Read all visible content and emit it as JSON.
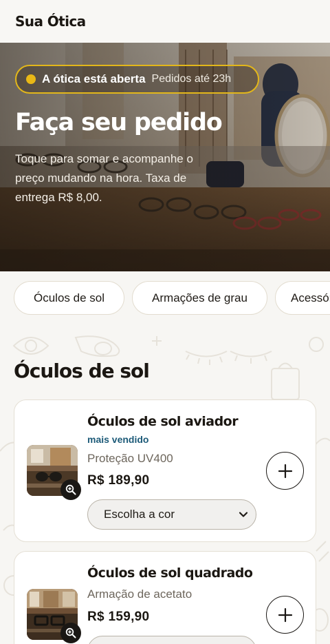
{
  "header": {
    "brand": "Sua Ótica"
  },
  "hero": {
    "status_main": "A ótica está aberta",
    "status_sub": "Pedidos até 23h",
    "status_color": "#e9b816",
    "title": "Faça seu pedido",
    "description": "Toque para somar e acompanhe o preço mudando na hora. Taxa de entrega R$ 8,00."
  },
  "categories": [
    "Óculos de sol",
    "Armações de grau",
    "Acessórios"
  ],
  "section": {
    "title": "Óculos de sol"
  },
  "products": [
    {
      "name": "Óculos de sol aviador",
      "badge": "mais vendido",
      "description": "Proteção UV400",
      "price": "R$ 189,90",
      "select_value": "Escolha a cor",
      "thumb_icon": "zoom-in-icon",
      "add_icon": "plus-icon"
    },
    {
      "name": "Óculos de sol quadrado",
      "description": "Armação de acetato",
      "price": "R$ 159,90",
      "thumb_icon": "zoom-in-icon",
      "add_icon": "plus-icon"
    }
  ]
}
